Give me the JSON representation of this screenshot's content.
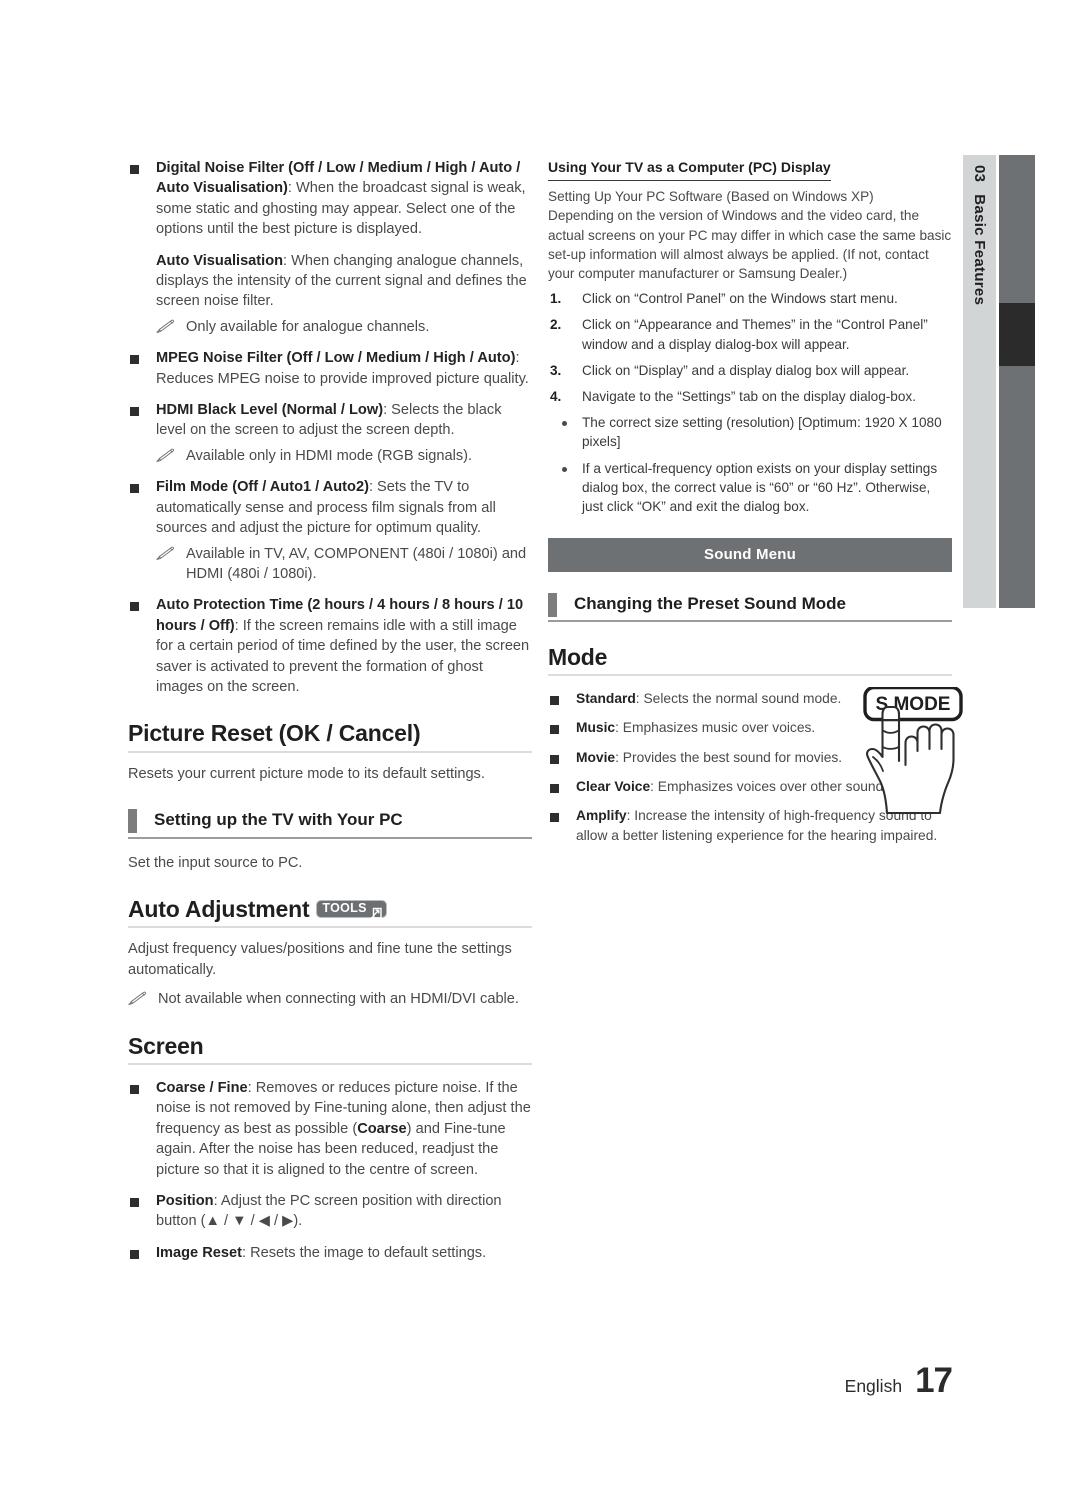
{
  "chapter_tab": {
    "number": "03",
    "name": "Basic Features"
  },
  "footer": {
    "language": "English",
    "page_number": "17"
  },
  "left_column": {
    "picture_options": [
      {
        "lead": "Digital Noise Filter (Off / Low / Medium / High / Auto / Auto Visualisation)",
        "body": ": When the broadcast signal is weak, some static and ghosting may appear. Select one of the options until the best picture is displayed.",
        "sub_lead": "Auto Visualisation",
        "sub_body": ": When changing analogue channels, displays the intensity of the current signal and defines the screen noise filter.",
        "note": "Only available for analogue channels."
      },
      {
        "lead": "MPEG Noise Filter (Off / Low / Medium / High / Auto)",
        "body": ": Reduces MPEG noise to provide improved picture quality."
      },
      {
        "lead": "HDMI Black Level (Normal / Low)",
        "body": ": Selects the black level on the screen to adjust the screen depth.",
        "note": "Available only in HDMI mode (RGB signals)."
      },
      {
        "lead": "Film Mode (Off / Auto1 / Auto2)",
        "body": ": Sets the TV to automatically sense and process film signals from all sources and adjust the picture for optimum quality.",
        "note": "Available in TV, AV, COMPONENT (480i / 1080i) and HDMI (480i / 1080i)."
      },
      {
        "lead": "Auto Protection Time (2 hours / 4 hours / 8 hours / 10 hours / Off)",
        "body": ":  If the screen remains idle with a still image for a certain period of time defined by the user, the screen saver is activated to prevent the formation of ghost images on the screen."
      }
    ],
    "picture_reset": {
      "heading": "Picture Reset (OK / Cancel)",
      "body": "Resets your current picture mode to its default settings."
    },
    "setting_up_pc": {
      "heading": "Setting up the TV with Your PC",
      "body": "Set the input source to PC."
    },
    "auto_adjustment": {
      "heading": "Auto Adjustment",
      "badge_label": "TOOLS",
      "badge_icon": "tools-enter-icon",
      "body": "Adjust frequency values/positions and fine tune the settings automatically.",
      "note": "Not available when connecting with an HDMI/DVI cable."
    },
    "screen": {
      "heading": "Screen",
      "items": [
        {
          "lead": "Coarse / Fine",
          "body": ": Removes or reduces picture noise. If the noise is not removed by Fine-tuning alone, then adjust the frequency as best as possible (",
          "body_bold2": "Coarse",
          "body_tail": ") and Fine-tune again. After the noise has been reduced, readjust the picture so that it is aligned to the centre of screen."
        },
        {
          "lead": "Position",
          "body": ": Adjust the PC screen position with direction button (▲ / ▼ / ◀ / ▶)."
        },
        {
          "lead": "Image Reset",
          "body": ": Resets the image to default settings."
        }
      ]
    }
  },
  "right_column": {
    "pc_display": {
      "heading": "Using Your TV as a Computer (PC) Display",
      "subheading": "Setting Up Your PC Software (Based on Windows XP)",
      "intro": "Depending on the version of Windows and the video card, the actual screens on your PC may differ in which case the same basic set-up information will almost always be applied. (If not, contact your computer manufacturer or Samsung Dealer.)",
      "steps": [
        {
          "index": "1.",
          "text": "Click on “Control Panel” on the Windows start menu."
        },
        {
          "index": "2.",
          "text": "Click on “Appearance and Themes” in the “Control Panel” window and a display dialog-box will appear."
        },
        {
          "index": "3.",
          "text": "Click on “Display” and a display dialog box will appear."
        },
        {
          "index": "4.",
          "text": "Navigate to the “Settings” tab on the display dialog-box."
        }
      ],
      "bullets": [
        "The correct size setting (resolution) [Optimum: 1920 X 1080 pixels]",
        "If a vertical-frequency option exists on your display settings dialog box, the correct value is “60” or “60 Hz”. Otherwise, just click “OK” and exit the dialog box."
      ]
    },
    "sound_menu_banner": "Sound Menu",
    "changing_preset": {
      "heading": "Changing the Preset Sound Mode"
    },
    "mode": {
      "heading": "Mode",
      "remote_button_label": "S.MODE",
      "items": [
        {
          "lead": "Standard",
          "body": ": Selects the normal sound mode."
        },
        {
          "lead": "Music",
          "body": ": Emphasizes music over voices."
        },
        {
          "lead": "Movie",
          "body": ": Provides the best sound for movies."
        },
        {
          "lead": "Clear Voice",
          "body": ": Emphasizes voices over other sounds."
        },
        {
          "lead": "Amplify",
          "body": ": Increase the intensity of high-frequency sound to allow a better listening experience for the hearing impaired."
        }
      ]
    }
  },
  "colors": {
    "banner_gray": "#6e7173",
    "tab_band": "#d2d5d6",
    "tab_dark": "#2b2b2b",
    "text": "#4a4a4a",
    "heading": "#1f1f1f"
  }
}
